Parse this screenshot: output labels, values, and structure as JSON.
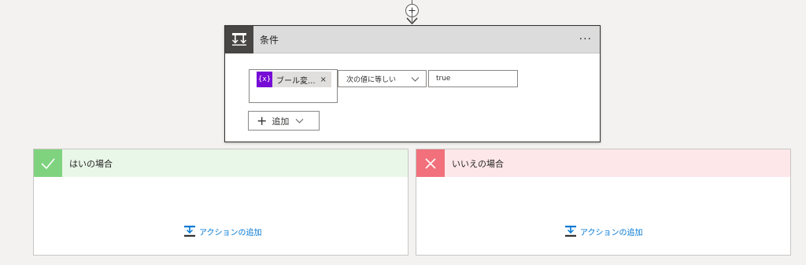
{
  "flow": {
    "add_step_icon": "plus-circle-icon"
  },
  "condition": {
    "title": "条件",
    "icon": "condition-icon",
    "more_label": "···",
    "row": {
      "token_icon_text": "{x}",
      "token_label": "ブール変...",
      "token_remove": "×",
      "operator": "次の値に等しい",
      "value": "true"
    },
    "add_label": "追加"
  },
  "branches": {
    "yes": {
      "title": "はいの場合",
      "add_action": "アクションの追加",
      "color": "#7fd37f"
    },
    "no": {
      "title": "いいえの場合",
      "add_action": "アクションの追加",
      "color": "#f1707b"
    }
  },
  "colors": {
    "accent": "#0078d4",
    "variable_token": "#770bd6",
    "header_dark": "#484644"
  }
}
